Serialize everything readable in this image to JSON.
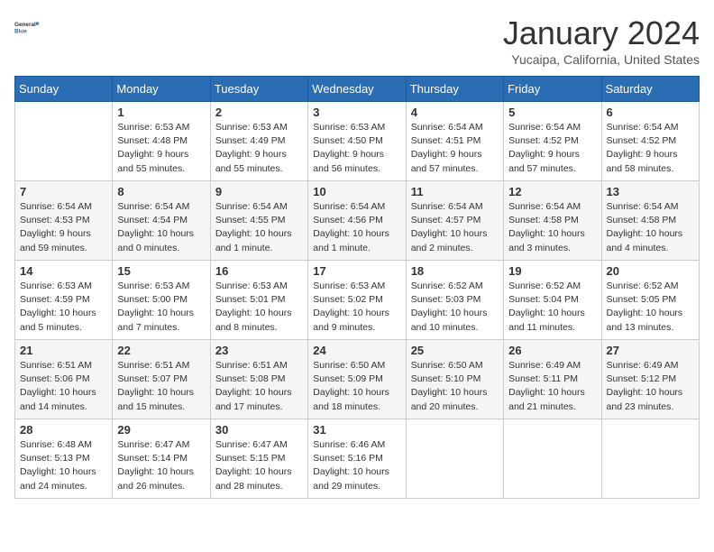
{
  "logo": {
    "line1": "General",
    "line2": "Blue"
  },
  "title": "January 2024",
  "subtitle": "Yucaipa, California, United States",
  "weekdays": [
    "Sunday",
    "Monday",
    "Tuesday",
    "Wednesday",
    "Thursday",
    "Friday",
    "Saturday"
  ],
  "weeks": [
    [
      {
        "day": "",
        "sunrise": "",
        "sunset": "",
        "daylight": ""
      },
      {
        "day": "1",
        "sunrise": "Sunrise: 6:53 AM",
        "sunset": "Sunset: 4:48 PM",
        "daylight": "Daylight: 9 hours and 55 minutes."
      },
      {
        "day": "2",
        "sunrise": "Sunrise: 6:53 AM",
        "sunset": "Sunset: 4:49 PM",
        "daylight": "Daylight: 9 hours and 55 minutes."
      },
      {
        "day": "3",
        "sunrise": "Sunrise: 6:53 AM",
        "sunset": "Sunset: 4:50 PM",
        "daylight": "Daylight: 9 hours and 56 minutes."
      },
      {
        "day": "4",
        "sunrise": "Sunrise: 6:54 AM",
        "sunset": "Sunset: 4:51 PM",
        "daylight": "Daylight: 9 hours and 57 minutes."
      },
      {
        "day": "5",
        "sunrise": "Sunrise: 6:54 AM",
        "sunset": "Sunset: 4:52 PM",
        "daylight": "Daylight: 9 hours and 57 minutes."
      },
      {
        "day": "6",
        "sunrise": "Sunrise: 6:54 AM",
        "sunset": "Sunset: 4:52 PM",
        "daylight": "Daylight: 9 hours and 58 minutes."
      }
    ],
    [
      {
        "day": "7",
        "sunrise": "Sunrise: 6:54 AM",
        "sunset": "Sunset: 4:53 PM",
        "daylight": "Daylight: 9 hours and 59 minutes."
      },
      {
        "day": "8",
        "sunrise": "Sunrise: 6:54 AM",
        "sunset": "Sunset: 4:54 PM",
        "daylight": "Daylight: 10 hours and 0 minutes."
      },
      {
        "day": "9",
        "sunrise": "Sunrise: 6:54 AM",
        "sunset": "Sunset: 4:55 PM",
        "daylight": "Daylight: 10 hours and 1 minute."
      },
      {
        "day": "10",
        "sunrise": "Sunrise: 6:54 AM",
        "sunset": "Sunset: 4:56 PM",
        "daylight": "Daylight: 10 hours and 1 minute."
      },
      {
        "day": "11",
        "sunrise": "Sunrise: 6:54 AM",
        "sunset": "Sunset: 4:57 PM",
        "daylight": "Daylight: 10 hours and 2 minutes."
      },
      {
        "day": "12",
        "sunrise": "Sunrise: 6:54 AM",
        "sunset": "Sunset: 4:58 PM",
        "daylight": "Daylight: 10 hours and 3 minutes."
      },
      {
        "day": "13",
        "sunrise": "Sunrise: 6:54 AM",
        "sunset": "Sunset: 4:58 PM",
        "daylight": "Daylight: 10 hours and 4 minutes."
      }
    ],
    [
      {
        "day": "14",
        "sunrise": "Sunrise: 6:53 AM",
        "sunset": "Sunset: 4:59 PM",
        "daylight": "Daylight: 10 hours and 5 minutes."
      },
      {
        "day": "15",
        "sunrise": "Sunrise: 6:53 AM",
        "sunset": "Sunset: 5:00 PM",
        "daylight": "Daylight: 10 hours and 7 minutes."
      },
      {
        "day": "16",
        "sunrise": "Sunrise: 6:53 AM",
        "sunset": "Sunset: 5:01 PM",
        "daylight": "Daylight: 10 hours and 8 minutes."
      },
      {
        "day": "17",
        "sunrise": "Sunrise: 6:53 AM",
        "sunset": "Sunset: 5:02 PM",
        "daylight": "Daylight: 10 hours and 9 minutes."
      },
      {
        "day": "18",
        "sunrise": "Sunrise: 6:52 AM",
        "sunset": "Sunset: 5:03 PM",
        "daylight": "Daylight: 10 hours and 10 minutes."
      },
      {
        "day": "19",
        "sunrise": "Sunrise: 6:52 AM",
        "sunset": "Sunset: 5:04 PM",
        "daylight": "Daylight: 10 hours and 11 minutes."
      },
      {
        "day": "20",
        "sunrise": "Sunrise: 6:52 AM",
        "sunset": "Sunset: 5:05 PM",
        "daylight": "Daylight: 10 hours and 13 minutes."
      }
    ],
    [
      {
        "day": "21",
        "sunrise": "Sunrise: 6:51 AM",
        "sunset": "Sunset: 5:06 PM",
        "daylight": "Daylight: 10 hours and 14 minutes."
      },
      {
        "day": "22",
        "sunrise": "Sunrise: 6:51 AM",
        "sunset": "Sunset: 5:07 PM",
        "daylight": "Daylight: 10 hours and 15 minutes."
      },
      {
        "day": "23",
        "sunrise": "Sunrise: 6:51 AM",
        "sunset": "Sunset: 5:08 PM",
        "daylight": "Daylight: 10 hours and 17 minutes."
      },
      {
        "day": "24",
        "sunrise": "Sunrise: 6:50 AM",
        "sunset": "Sunset: 5:09 PM",
        "daylight": "Daylight: 10 hours and 18 minutes."
      },
      {
        "day": "25",
        "sunrise": "Sunrise: 6:50 AM",
        "sunset": "Sunset: 5:10 PM",
        "daylight": "Daylight: 10 hours and 20 minutes."
      },
      {
        "day": "26",
        "sunrise": "Sunrise: 6:49 AM",
        "sunset": "Sunset: 5:11 PM",
        "daylight": "Daylight: 10 hours and 21 minutes."
      },
      {
        "day": "27",
        "sunrise": "Sunrise: 6:49 AM",
        "sunset": "Sunset: 5:12 PM",
        "daylight": "Daylight: 10 hours and 23 minutes."
      }
    ],
    [
      {
        "day": "28",
        "sunrise": "Sunrise: 6:48 AM",
        "sunset": "Sunset: 5:13 PM",
        "daylight": "Daylight: 10 hours and 24 minutes."
      },
      {
        "day": "29",
        "sunrise": "Sunrise: 6:47 AM",
        "sunset": "Sunset: 5:14 PM",
        "daylight": "Daylight: 10 hours and 26 minutes."
      },
      {
        "day": "30",
        "sunrise": "Sunrise: 6:47 AM",
        "sunset": "Sunset: 5:15 PM",
        "daylight": "Daylight: 10 hours and 28 minutes."
      },
      {
        "day": "31",
        "sunrise": "Sunrise: 6:46 AM",
        "sunset": "Sunset: 5:16 PM",
        "daylight": "Daylight: 10 hours and 29 minutes."
      },
      {
        "day": "",
        "sunrise": "",
        "sunset": "",
        "daylight": ""
      },
      {
        "day": "",
        "sunrise": "",
        "sunset": "",
        "daylight": ""
      },
      {
        "day": "",
        "sunrise": "",
        "sunset": "",
        "daylight": ""
      }
    ]
  ]
}
